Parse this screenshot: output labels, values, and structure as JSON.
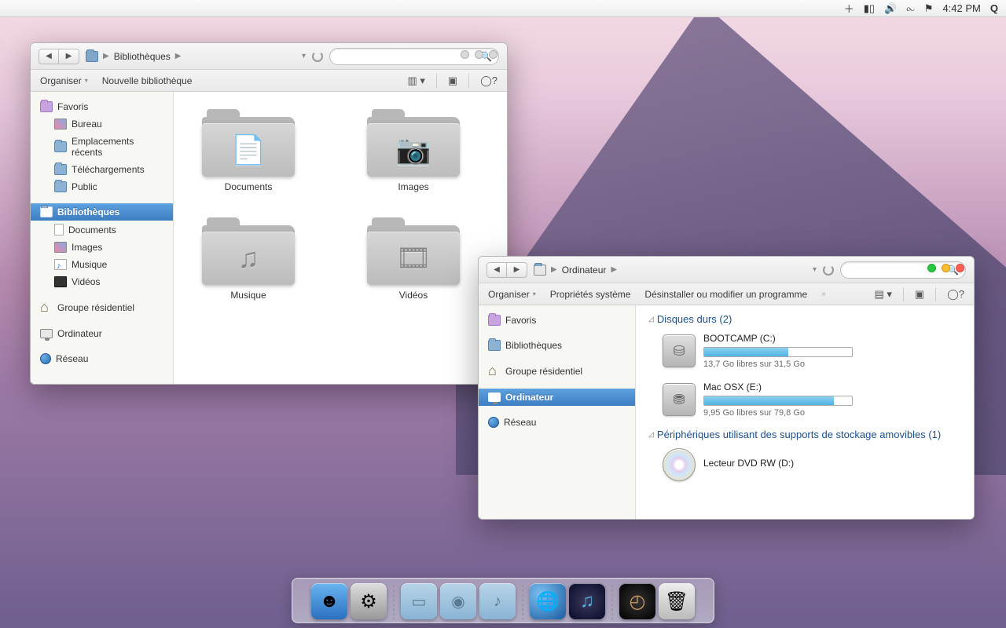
{
  "menubar": {
    "time": "4:42 PM"
  },
  "win1": {
    "breadcrumb": "Bibliothèques",
    "toolbar": {
      "organize": "Organiser",
      "newlib": "Nouvelle bibliothèque"
    },
    "sidebar": {
      "favorites": "Favoris",
      "desktop": "Bureau",
      "recent": "Emplacements récents",
      "downloads": "Téléchargements",
      "public": "Public",
      "libraries": "Bibliothèques",
      "documents": "Documents",
      "images": "Images",
      "music": "Musique",
      "videos": "Vidéos",
      "homegroup": "Groupe résidentiel",
      "computer": "Ordinateur",
      "network": "Réseau"
    },
    "folders": {
      "documents": "Documents",
      "images": "Images",
      "music": "Musique",
      "videos": "Vidéos"
    }
  },
  "win2": {
    "breadcrumb": "Ordinateur",
    "toolbar": {
      "organize": "Organiser",
      "sysprops": "Propriétés système",
      "uninstall": "Désinstaller ou modifier un programme"
    },
    "sidebar": {
      "favorites": "Favoris",
      "libraries": "Bibliothèques",
      "homegroup": "Groupe résidentiel",
      "computer": "Ordinateur",
      "network": "Réseau"
    },
    "sections": {
      "hdd": "Disques durs (2)",
      "removable": "Périphériques utilisant des supports de stockage amovibles (1)"
    },
    "drives": {
      "bootcamp": {
        "name": "BOOTCAMP (C:)",
        "free": "13,7 Go libres sur 31,5 Go",
        "pct": 57
      },
      "macosx": {
        "name": "Mac OSX (E:)",
        "free": "9,95 Go libres sur 79,8 Go",
        "pct": 88
      },
      "dvd": {
        "name": "Lecteur DVD RW (D:)"
      }
    }
  }
}
